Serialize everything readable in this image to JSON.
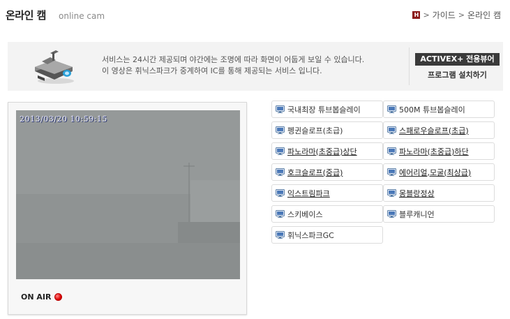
{
  "header": {
    "title": "온라인 캠",
    "subtitle": "online cam"
  },
  "breadcrumb": {
    "home_icon": "H",
    "items": [
      "가이드",
      "온라인 캠"
    ],
    "separator": ">"
  },
  "notice": {
    "line1": "서비스는 24시간 제공되며 야간에는 조명에 따라 화면이 어둡게 보일 수 있습니다.",
    "line2": "이 영상은 휘닉스파크가 중계하여 IC를 통해 제공되는 서비스 입니다.",
    "activex_label": "ACTIVEX+ 전용뷰어",
    "install_label": "프로그램 설치하기"
  },
  "video": {
    "timestamp": "2013/03/20 10:59:15",
    "status_label": "ON AIR"
  },
  "cameras": [
    {
      "label": "국내최장 튜브봅슬레이",
      "linked": false
    },
    {
      "label": "500M 튜브봅슬레이",
      "linked": false
    },
    {
      "label": "펭귄슬로프(초급)",
      "linked": false
    },
    {
      "label": "스패로우슬로프(초급)",
      "linked": true
    },
    {
      "label": "파노라마(초중급)상단",
      "linked": true
    },
    {
      "label": "파노라마(초중급)하단",
      "linked": true
    },
    {
      "label": "호크슬로프(중급)",
      "linked": true
    },
    {
      "label": "에어리얼,모굴(최상급)",
      "linked": true
    },
    {
      "label": "익스트림파크",
      "linked": true
    },
    {
      "label": "몽블랑정상",
      "linked": true
    },
    {
      "label": "스키베이스",
      "linked": false
    },
    {
      "label": "블루캐니언",
      "linked": false
    },
    {
      "label": "휘닉스파크GC",
      "linked": false
    }
  ],
  "icons": {
    "camera": "webcam-icon",
    "monitor": "monitor-icon",
    "record": "record-indicator-icon"
  },
  "colors": {
    "brand": "#8b1a1a",
    "activex_bg": "#3a3a3a",
    "notice_bg": "#f3f3f3",
    "rec": "#dd0000"
  }
}
